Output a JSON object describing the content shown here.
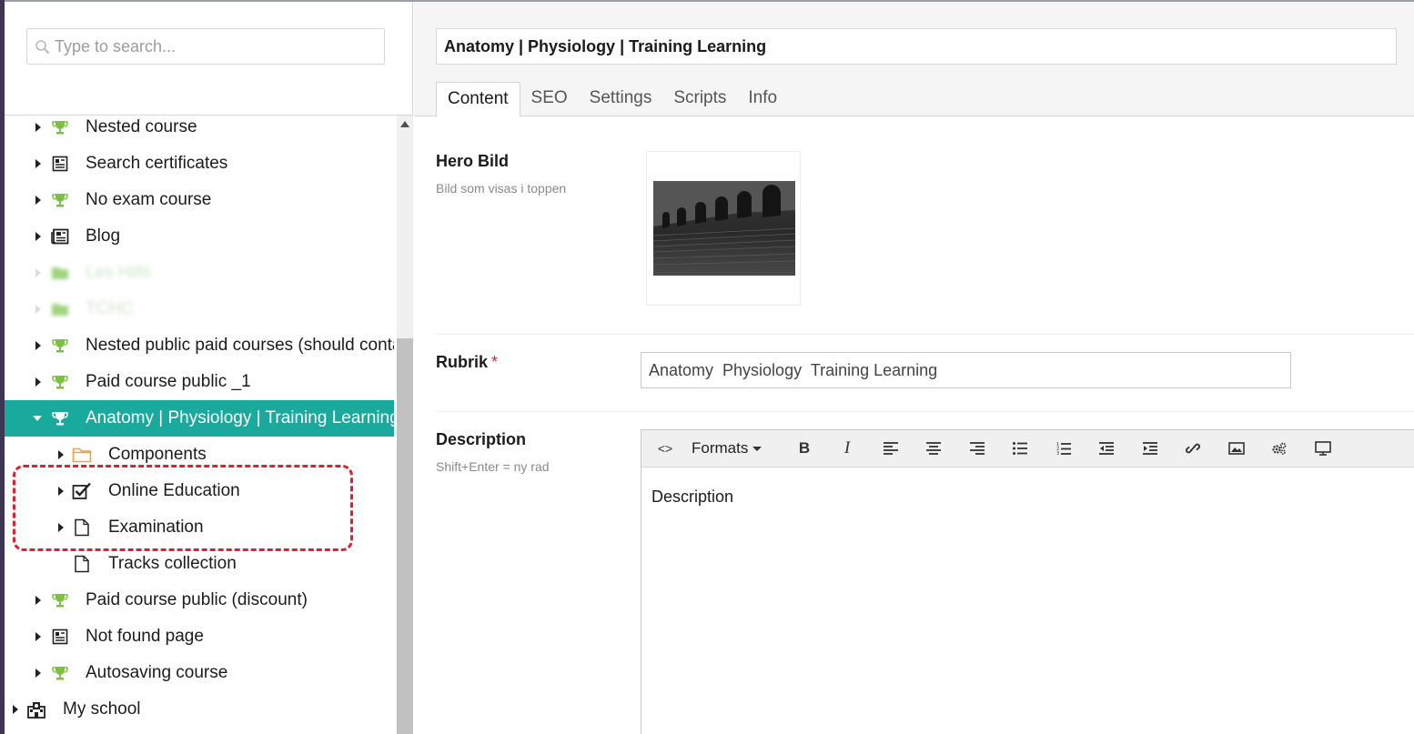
{
  "sidebar": {
    "search_placeholder": "Type to search...",
    "items": [
      {
        "label": "Nested course",
        "icon": "trophy-icon"
      },
      {
        "label": "Search certificates",
        "icon": "certificate-icon"
      },
      {
        "label": "No exam course",
        "icon": "trophy-icon"
      },
      {
        "label": "Blog",
        "icon": "newspaper-icon"
      },
      {
        "label": "Les Hills",
        "icon": "folder-icon"
      },
      {
        "label": "TCHC",
        "icon": "folder-icon"
      },
      {
        "label": "Nested public paid courses (should contain",
        "icon": "trophy-icon"
      },
      {
        "label": "Paid course public _1",
        "icon": "trophy-icon"
      },
      {
        "label": "Anatomy | Physiology | Training Learning",
        "icon": "trophy-icon"
      },
      {
        "label": "Components",
        "icon": "folder-icon"
      },
      {
        "label": "Online Education",
        "icon": "checkbox-icon"
      },
      {
        "label": "Examination",
        "icon": "document-icon"
      },
      {
        "label": "Tracks collection",
        "icon": "document-icon"
      },
      {
        "label": "Paid course public (discount)",
        "icon": "trophy-icon"
      },
      {
        "label": "Not found page",
        "icon": "certificate-icon"
      },
      {
        "label": "Autosaving course",
        "icon": "trophy-icon"
      },
      {
        "label": "My school",
        "icon": "school-icon"
      }
    ]
  },
  "editor": {
    "title": "Anatomy | Physiology | Training Learning",
    "tabs": [
      "Content",
      "SEO",
      "Settings",
      "Scripts",
      "Info"
    ],
    "active_tab": "Content",
    "hero": {
      "label": "Hero Bild",
      "description": "Bild som visas i toppen"
    },
    "rubrik": {
      "label": "Rubrik",
      "required_marker": "*",
      "value": "Anatomy  Physiology  Training Learning"
    },
    "description": {
      "label": "Description",
      "hint": "Shift+Enter = ny rad",
      "toolbar_formats": "Formats",
      "toolbar_code": "<>",
      "toolbar_bold": "B",
      "toolbar_italic": "I",
      "content": "Description"
    }
  },
  "colors": {
    "active_row": "#1aa99d",
    "trophy": "#7cc242",
    "highlight": "#d9232e",
    "folder": "#f0a33a"
  }
}
